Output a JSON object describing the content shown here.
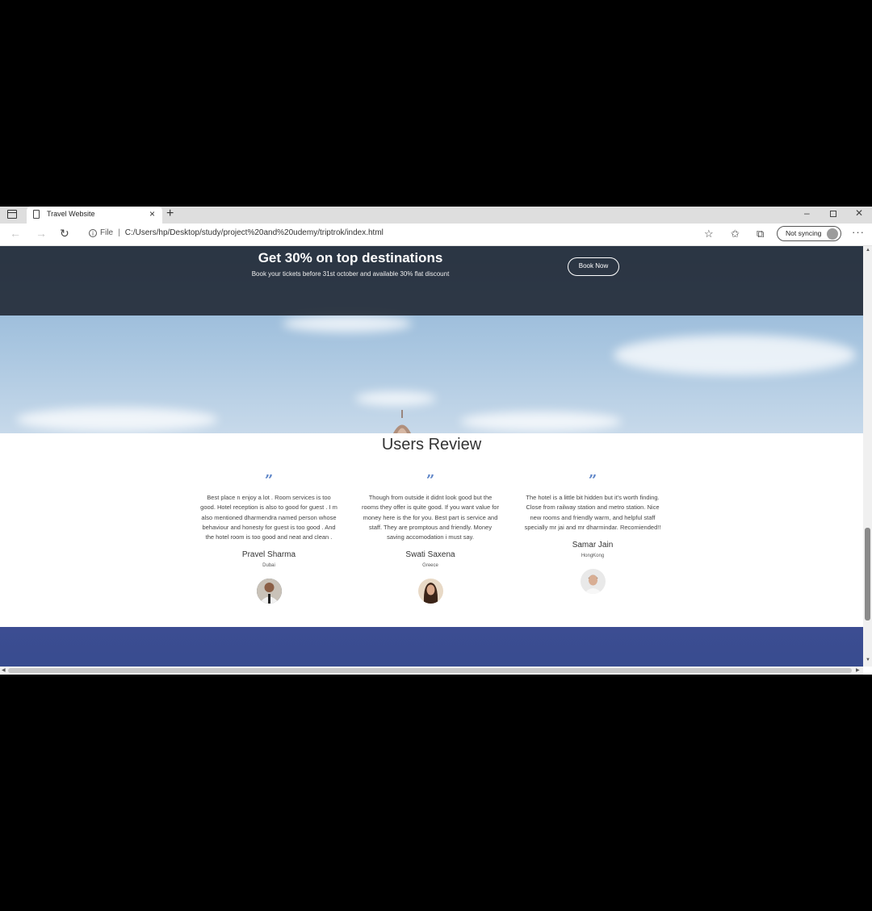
{
  "browser": {
    "tab": {
      "title": "Travel Website"
    },
    "toolbar": {
      "file_label": "File",
      "url": "C:/Users/hp/Desktop/study/project%20and%20udemy/triptrok/index.html",
      "sync_label": "Not syncing"
    }
  },
  "promo": {
    "title": "Get 30% on top destinations",
    "subtitle": "Book your tickets before 31st october and available 30% flat discount",
    "button": "Book Now"
  },
  "reviews": {
    "title": "Users Review",
    "quote_mark": "”",
    "items": [
      {
        "text": "Best place n enjoy a lot . Room services is too good. Hotel reception is also to good for guest . I m also mentioned dharmendra named person whose behaviour and honesty for guest is too good . And the hotel room is too good and neat and clean .",
        "name": "Pravel Sharma",
        "location": "Dubai"
      },
      {
        "text": "Though from outside it didnt look good but the rooms they offer is quite good. If you want value for money here is the for you. Best part is service and staff. They are promptous and friendly. Money saving accomodation i must say.",
        "name": "Swati Saxena",
        "location": "Greece"
      },
      {
        "text": "The hotel is a little bit hidden but it's worth finding. Close from railway station and metro station. Nice new rooms and friendly warm, and helpful staff specially mr jai and mr dharmindar. Recomiended!!",
        "name": "Samar Jain",
        "location": "HongKong"
      }
    ]
  },
  "colors": {
    "accent_quote": "#5f86c8",
    "footer": "#3c4d92",
    "promo_overlay": "#1e2430"
  },
  "icons": [
    "browser-menu-icon",
    "page-icon",
    "close-icon",
    "plus-icon",
    "minimize-icon",
    "restore-icon",
    "back-icon",
    "forward-icon",
    "refresh-icon",
    "info-icon",
    "favorites-add-icon",
    "favorites-icon",
    "collections-icon",
    "profile-avatar-icon",
    "more-icon"
  ]
}
